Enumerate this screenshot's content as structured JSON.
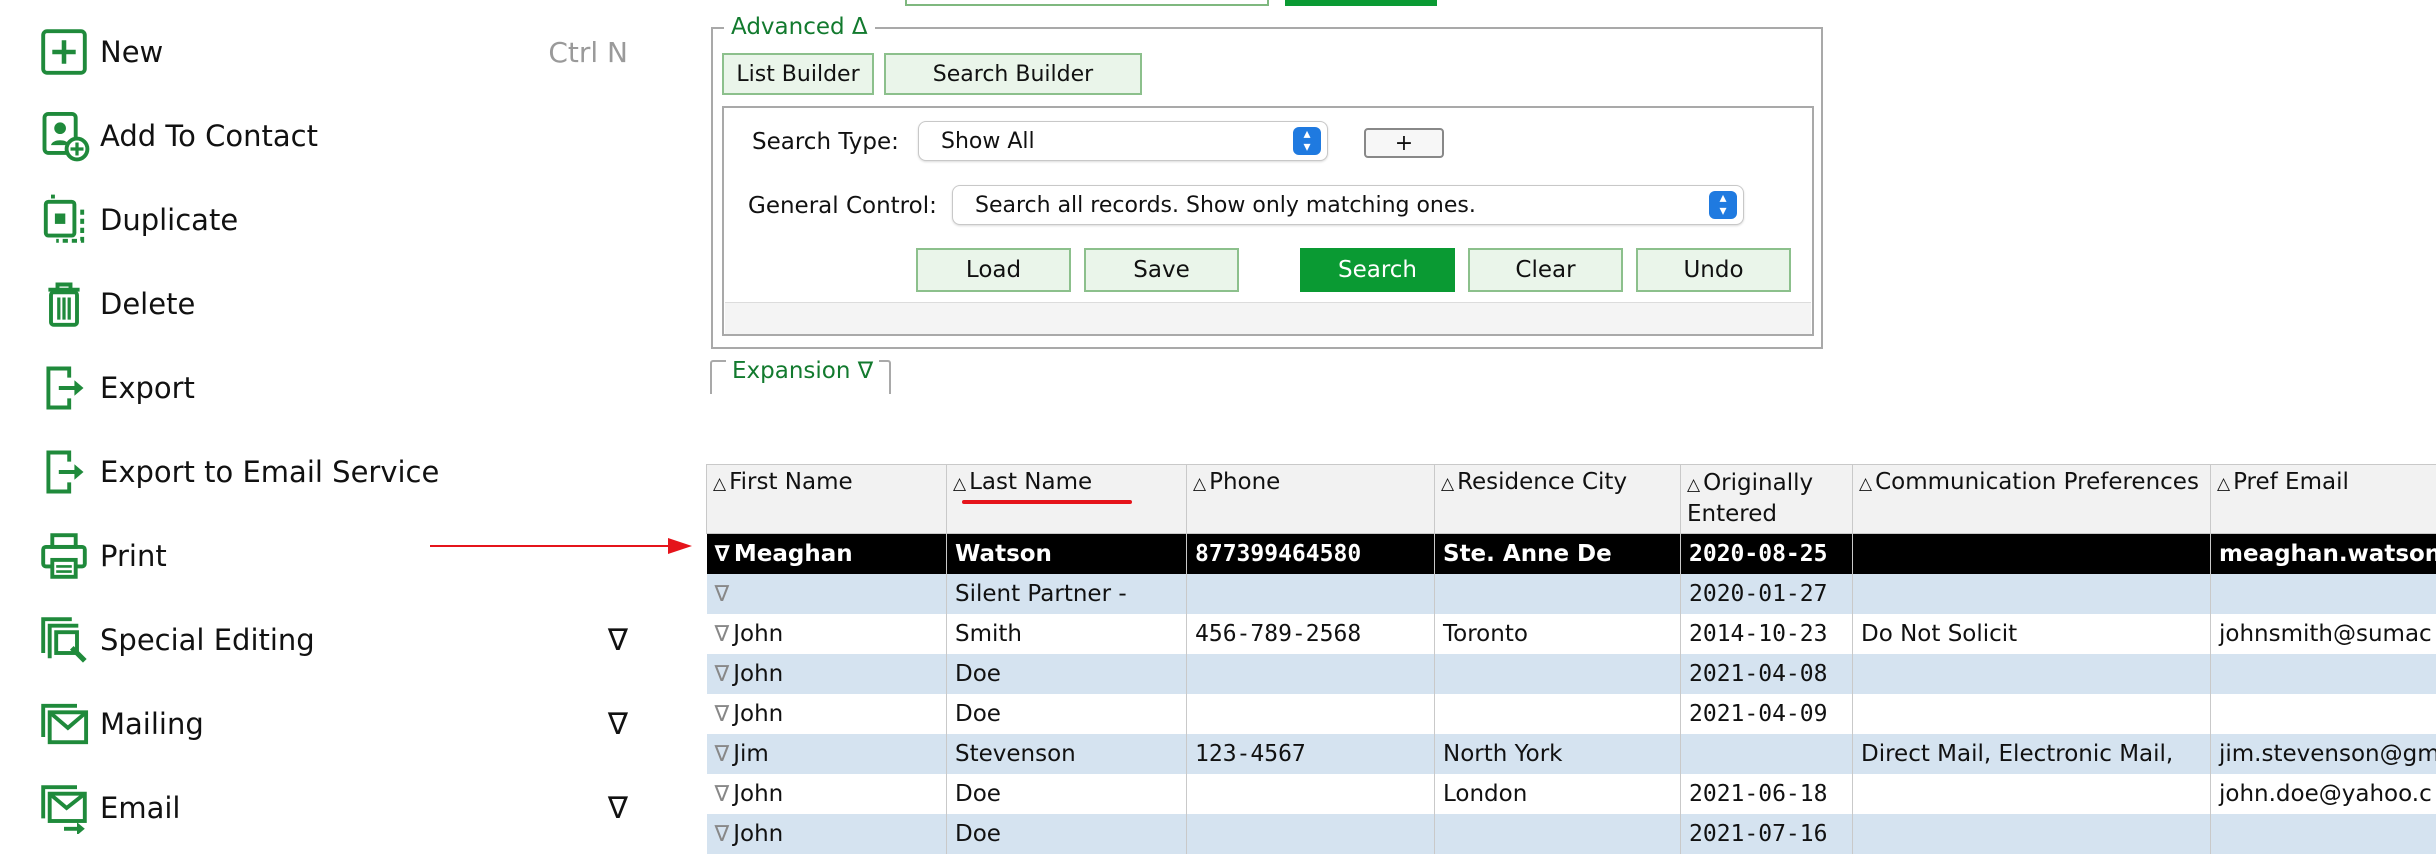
{
  "menu": {
    "new": {
      "label": "New",
      "shortcut": "Ctrl N"
    },
    "add_to_contact": {
      "label": "Add To Contact"
    },
    "duplicate": {
      "label": "Duplicate"
    },
    "delete": {
      "label": "Delete"
    },
    "export": {
      "label": "Export"
    },
    "export_email": {
      "label": "Export to Email Service"
    },
    "print": {
      "label": "Print"
    },
    "special_editing": {
      "label": "Special Editing",
      "expand": "∇"
    },
    "mailing": {
      "label": "Mailing",
      "expand": "∇"
    },
    "email": {
      "label": "Email",
      "expand": "∇"
    }
  },
  "advanced": {
    "legend": "Advanced Δ",
    "list_builder": "List Builder",
    "search_builder": "Search Builder",
    "search_type_label": "Search Type:",
    "search_type_value": "Show All",
    "plus": "+",
    "general_control_label": "General Control:",
    "general_control_value": "Search all records. Show only matching ones.",
    "load": "Load",
    "save": "Save",
    "search": "Search",
    "clear": "Clear",
    "undo": "Undo"
  },
  "expansion": {
    "label": "Expansion ∇"
  },
  "table": {
    "headers": {
      "first_name": "First Name",
      "last_name": "Last Name",
      "phone": "Phone",
      "residence_city": "Residence City",
      "originally": "Originally",
      "entered": "Entered",
      "communication": "Communication Preferences",
      "pref_email": "Pref Email"
    },
    "rows": [
      {
        "first": "Meaghan",
        "last": "Watson",
        "phone": "877399464580",
        "city": "Ste. Anne De",
        "date": "2020-08-25",
        "comm": "",
        "email": "meaghan.watson@"
      },
      {
        "first": "",
        "last": "Silent Partner -",
        "phone": "",
        "city": "",
        "date": "2020-01-27",
        "comm": "",
        "email": ""
      },
      {
        "first": "John",
        "last": "Smith",
        "phone": "456-789-2568",
        "city": "Toronto",
        "date": "2014-10-23",
        "comm": "Do Not Solicit",
        "email": "johnsmith@sumac"
      },
      {
        "first": "John",
        "last": "Doe",
        "phone": "",
        "city": "",
        "date": "2021-04-08",
        "comm": "",
        "email": ""
      },
      {
        "first": "John",
        "last": "Doe",
        "phone": "",
        "city": "",
        "date": "2021-04-09",
        "comm": "",
        "email": ""
      },
      {
        "first": "Jim",
        "last": "Stevenson",
        "phone": "123-4567",
        "city": "North York",
        "date": "",
        "comm": "Direct Mail, Electronic Mail,",
        "email": "jim.stevenson@gm"
      },
      {
        "first": "John",
        "last": "Doe",
        "phone": "",
        "city": "London",
        "date": "2021-06-18",
        "comm": "",
        "email": "john.doe@yahoo.c"
      },
      {
        "first": "John",
        "last": "Doe",
        "phone": "",
        "city": "",
        "date": "2021-07-16",
        "comm": "",
        "email": ""
      }
    ]
  },
  "colors": {
    "accent_green": "#0a9a33",
    "selected_row": "#000000",
    "alt_row": "#d5e3f0",
    "annotation_red": "#e5141b"
  }
}
